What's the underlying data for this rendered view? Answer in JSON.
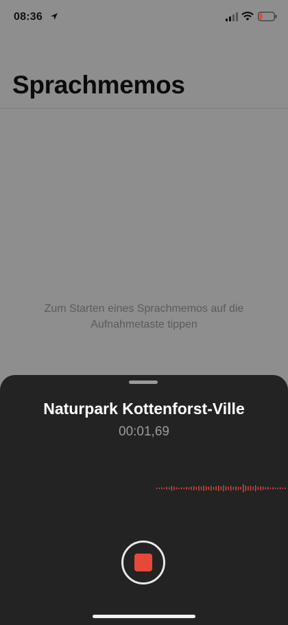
{
  "status_bar": {
    "time": "08:36",
    "icons": [
      "location-arrow-icon",
      "cellular-signal-icon",
      "wifi-icon",
      "battery-low-icon"
    ]
  },
  "header": {
    "title": "Sprachmemos"
  },
  "main": {
    "empty_hint": "Zum Starten eines Sprachmemos auf die Aufnahmetaste tippen"
  },
  "recording_sheet": {
    "title": "Naturpark Kottenforst-Ville",
    "elapsed": "00:01,69",
    "control": "stop-icon"
  },
  "colors": {
    "record_red": "#e5493a",
    "sheet_bg": "#232323",
    "waveform": "#e04a3c"
  }
}
